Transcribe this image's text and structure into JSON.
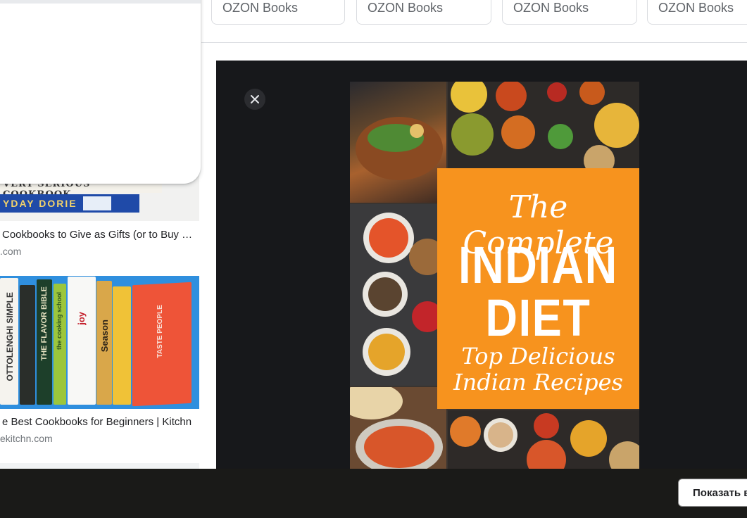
{
  "chips": [
    "OZON Books",
    "OZON Books",
    "OZON Books",
    "OZON Books"
  ],
  "results": [
    {
      "title": "Cookbooks to Give as Gifts (or to Buy …",
      "source": ".com",
      "thumb_text_top": "VERY SERIOUS COOKBOOK",
      "thumb_text_bottom": "YDAY DORIE"
    },
    {
      "title": "e Best Cookbooks for Beginners | Kitchn",
      "source": "ekitchn.com",
      "spines": [
        "OTTOLENGHI SIMPLE",
        "THE FLAVOR BIBLE",
        "the cooking school",
        "joy",
        "Season",
        "TASTE PEOPLE"
      ]
    }
  ],
  "preview": {
    "close_icon": "close-icon",
    "cover": {
      "line1": "The Complete",
      "line2": "INDIAN",
      "line3": "DIET",
      "line4": "Top Delicious",
      "line5": "Indian Recipes"
    }
  },
  "bottom_bar": {
    "show_button": "Показать в"
  },
  "colors": {
    "preview_bg": "#17181b",
    "cover_orange": "#f7931e",
    "bottom_bar": "#1a1a18"
  }
}
